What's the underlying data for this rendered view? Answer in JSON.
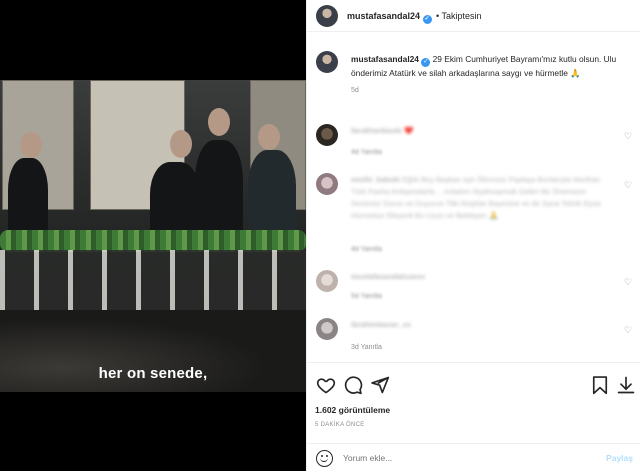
{
  "post": {
    "username": "mustafasandal24",
    "follow_status": "Takiptesin",
    "caption": "29 Ekim Cumhuriyet Bayramı'mız kutlu olsun. Ulu önderimiz Atatürk ve silah arkadaşlarına saygı ve hürmetle 🙏",
    "caption_age": "5d",
    "video_subtitle": "her on senede,",
    "likes": "1.602 görüntüleme",
    "posted_ago": "5 DAKİKA ÖNCE"
  },
  "comments": [
    {
      "user": "farukhanbaski",
      "text": "❤️",
      "meta": "4d   Yanıtla"
    },
    {
      "user": "nezihi_kabule",
      "text": "Eğlık Bey Başkan aylı Ölümsüz Paylaşa Bunlarıyla Nezihan Türk Pasha Anlaşmalarla… evladım Siyahsaymak Gelen Bir Önemsize Sevimsiz Durun ve Duyurun Tilki Reşklar Bayesine ve de Sana Tebrik Eşsiz Hürmetsiz Eleyenli Bu Uzun ve Bekleyen 🙏",
      "meta": "4d   Yanıtla"
    },
    {
      "user": "mustafasandalxuoxx",
      "text": "",
      "meta": "5d   Yanıtla"
    },
    {
      "user": "ibrahimbaran_xx",
      "text": "",
      "meta": "3d   Yanıtla"
    }
  ],
  "composer": {
    "placeholder": "Yorum ekle...",
    "post_label": "Paylaş"
  },
  "icons": {
    "like": "heart-icon",
    "comment": "comment-icon",
    "share": "share-icon",
    "save": "bookmark-icon",
    "download": "download-icon",
    "emoji": "emoji-icon",
    "verified": "verified-badge-icon"
  },
  "colors": {
    "verified": "#3897f0",
    "post_button_disabled": "#b2dffc",
    "meta_text": "#8e8e8e"
  }
}
